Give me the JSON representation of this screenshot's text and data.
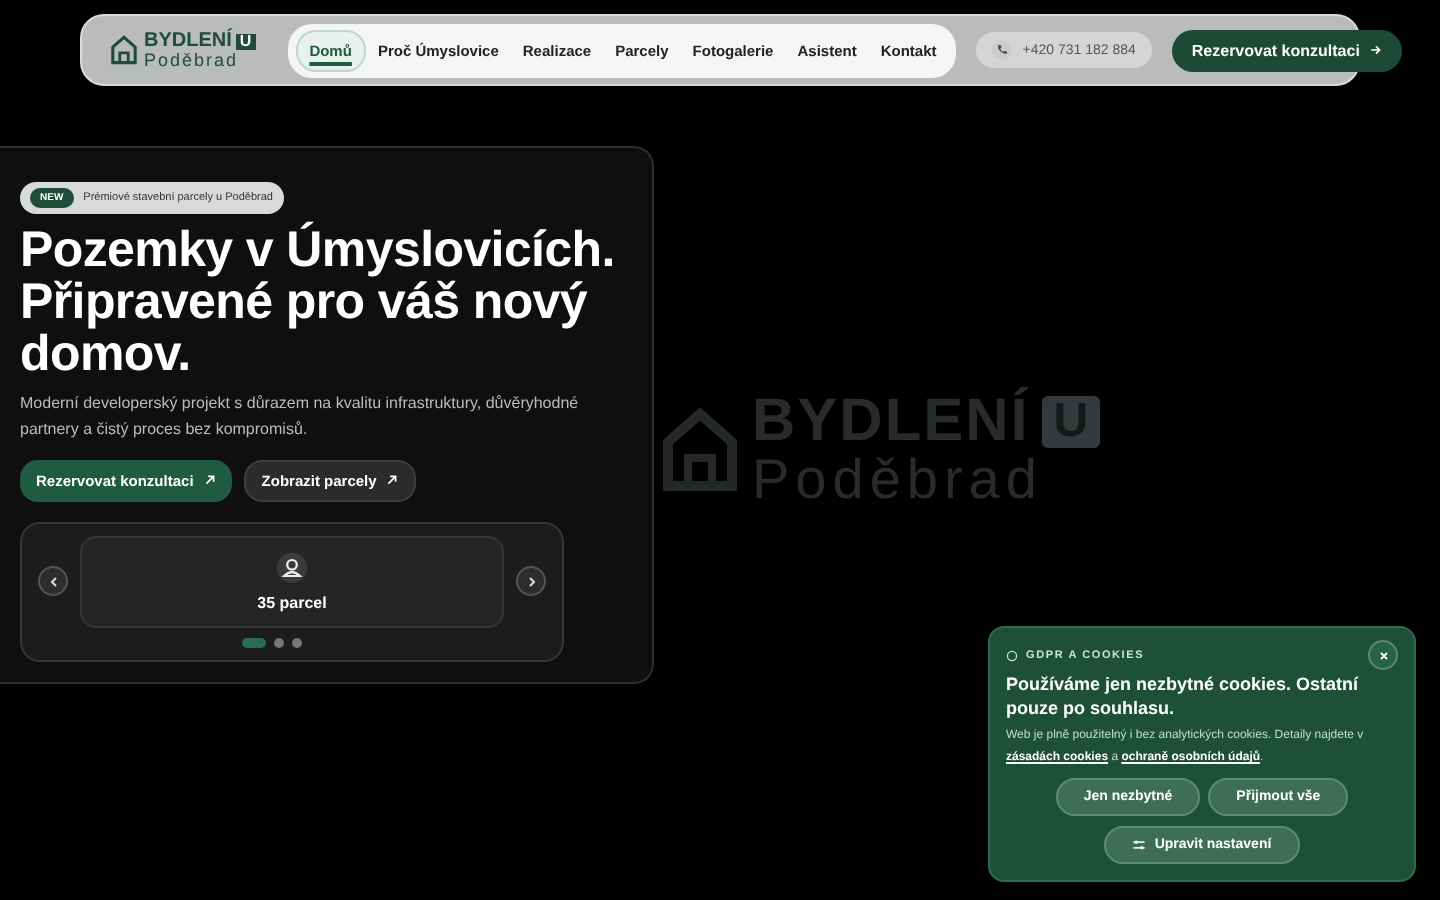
{
  "header": {
    "logo": {
      "word": "BYDLENÍ",
      "badge": "U",
      "place": "Poděbrad"
    },
    "nav": [
      {
        "label": "Domů",
        "selected": true
      },
      {
        "label": "Proč Úmyslovice",
        "selected": false
      },
      {
        "label": "Realizace",
        "selected": false
      },
      {
        "label": "Parcely",
        "selected": false
      },
      {
        "label": "Fotogalerie",
        "selected": false
      },
      {
        "label": "Asistent",
        "selected": false
      },
      {
        "label": "Kontakt",
        "selected": false
      }
    ],
    "phone": "+420 731 182 884",
    "cta": "Rezervovat konzultaci"
  },
  "background_logo": {
    "word": "BYDLENÍ",
    "badge": "U",
    "place": "Poděbrad"
  },
  "hero": {
    "badge": "NEW",
    "badge_text": "Prémiové stavební parcely u Poděbrad",
    "title": "Pozemky v Úmyslovicích. Připravené pro váš nový domov.",
    "description": "Moderní developerský projekt s důrazem na kvalitu infrastruktury, důvěryhodné partnery a čistý proces bez kompromisů.",
    "buttons": [
      {
        "label": "Rezervovat konzultaci",
        "kind": "primary"
      },
      {
        "label": "Zobrazit parcely",
        "kind": "secondary"
      }
    ],
    "carousel": {
      "stat": "35 parcel",
      "dots": [
        {
          "selected": true
        },
        {
          "selected": false
        },
        {
          "selected": false
        }
      ]
    }
  },
  "cookie_banner": {
    "eyebrow": "GDPR A COOKIES",
    "title": "Používáme jen nezbytné cookies. Ostatní pouze po souhlasu.",
    "text": [
      {
        "kind": "text",
        "text": "Web je plně použitelný i bez analytických cookies. Detaily najdete v "
      },
      {
        "kind": "link",
        "text": "zásadách cookies"
      },
      {
        "kind": "text",
        "text": " a "
      },
      {
        "kind": "link",
        "text": "ochraně osobních údajů"
      },
      {
        "kind": "text",
        "text": "."
      }
    ],
    "buttons": [
      "Jen nezbytné",
      "Přijmout vše"
    ],
    "settings": "Upravit nastavení"
  }
}
